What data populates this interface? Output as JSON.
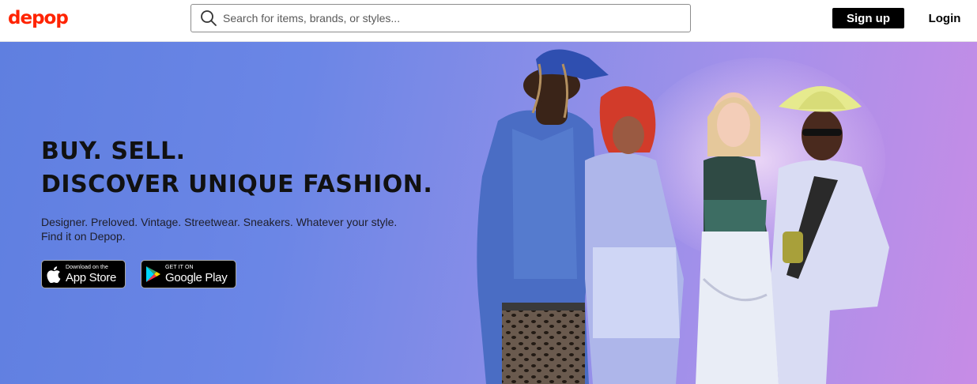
{
  "header": {
    "logo": "depop",
    "search_placeholder": "Search for items, brands, or styles...",
    "search_value": "",
    "signup_label": "Sign up",
    "login_label": "Login"
  },
  "hero": {
    "headline_line1": "BUY. SELL.",
    "headline_line2": "DISCOVER UNIQUE FASHION.",
    "subtext": "Designer. Preloved. Vintage. Streetwear. Sneakers. Whatever your style. Find it on Depop.",
    "app_store": {
      "small": "Download on the",
      "big": "App Store",
      "icon": "apple-icon"
    },
    "google_play": {
      "small": "GET IT ON",
      "big": "Google Play",
      "icon": "google-play-icon"
    }
  },
  "colors": {
    "brand": "#ff2300",
    "hero_bg_left": "#5f7fe0",
    "hero_bg_right": "#c78ce6",
    "button_dark": "#000000"
  }
}
